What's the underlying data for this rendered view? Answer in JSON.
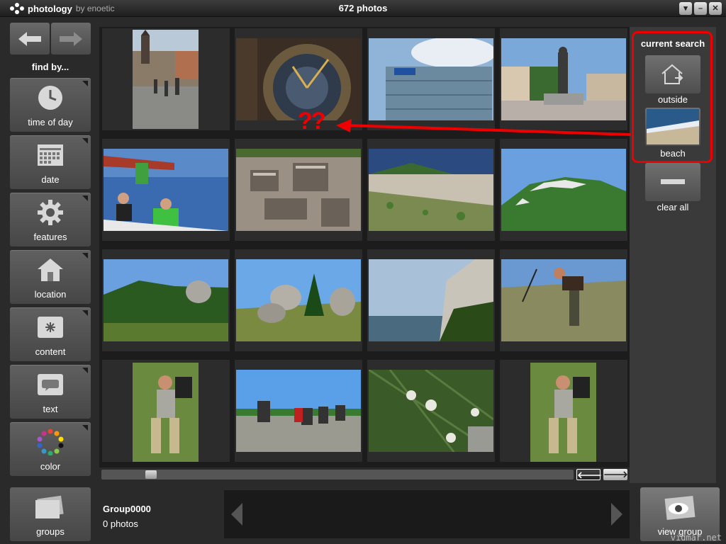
{
  "app": {
    "name": "photology",
    "by": "by enoetic",
    "photo_count": "672 photos"
  },
  "window": {
    "controls": [
      "menu-dropdown",
      "minimize",
      "close"
    ]
  },
  "left": {
    "find_by": "find by...",
    "categories": [
      {
        "label": "time of day",
        "icon": "clock-icon"
      },
      {
        "label": "date",
        "icon": "calendar-icon"
      },
      {
        "label": "features",
        "icon": "gear-icon"
      },
      {
        "label": "location",
        "icon": "house-icon"
      },
      {
        "label": "content",
        "icon": "asterisk-icon"
      },
      {
        "label": "text",
        "icon": "speech-bubble-icon"
      },
      {
        "label": "color",
        "icon": "color-wheel-icon"
      }
    ],
    "groups_label": "groups"
  },
  "current_search": {
    "title": "current search",
    "items": [
      {
        "label": "outside",
        "icon": "outside-house-icon"
      },
      {
        "label": "beach",
        "icon": "beach-thumbnail"
      }
    ],
    "clear_label": "clear all"
  },
  "annotation": {
    "marks": "??"
  },
  "group": {
    "name": "Group0000",
    "count": "0 photos",
    "view_label": "view group"
  },
  "pagination": {
    "prev": "🡐",
    "next": "🡒"
  },
  "scroll": {
    "position": 0.03
  },
  "watermark": "vidmar.net",
  "photos": [
    {
      "scene": "city-street",
      "orientation": "portrait"
    },
    {
      "scene": "astronomical-clock",
      "orientation": "landscape"
    },
    {
      "scene": "glass-building",
      "orientation": "landscape"
    },
    {
      "scene": "statue-square",
      "orientation": "landscape"
    },
    {
      "scene": "sailing",
      "orientation": "landscape"
    },
    {
      "scene": "ruins",
      "orientation": "landscape"
    },
    {
      "scene": "coastal-hill",
      "orientation": "landscape"
    },
    {
      "scene": "green-mountain",
      "orientation": "landscape"
    },
    {
      "scene": "grassy-hill",
      "orientation": "landscape"
    },
    {
      "scene": "rocks-tree",
      "orientation": "landscape"
    },
    {
      "scene": "cliff-valley",
      "orientation": "landscape"
    },
    {
      "scene": "hiker",
      "orientation": "landscape"
    },
    {
      "scene": "resting-hiker",
      "orientation": "portrait"
    },
    {
      "scene": "group-resting",
      "orientation": "landscape"
    },
    {
      "scene": "edelweiss",
      "orientation": "landscape"
    },
    {
      "scene": "resting-hiker",
      "orientation": "portrait"
    }
  ],
  "colors": {
    "accent_red": "#ee0000",
    "panel": "#3a3a3a",
    "grid_bg": "#1c1c1c"
  }
}
